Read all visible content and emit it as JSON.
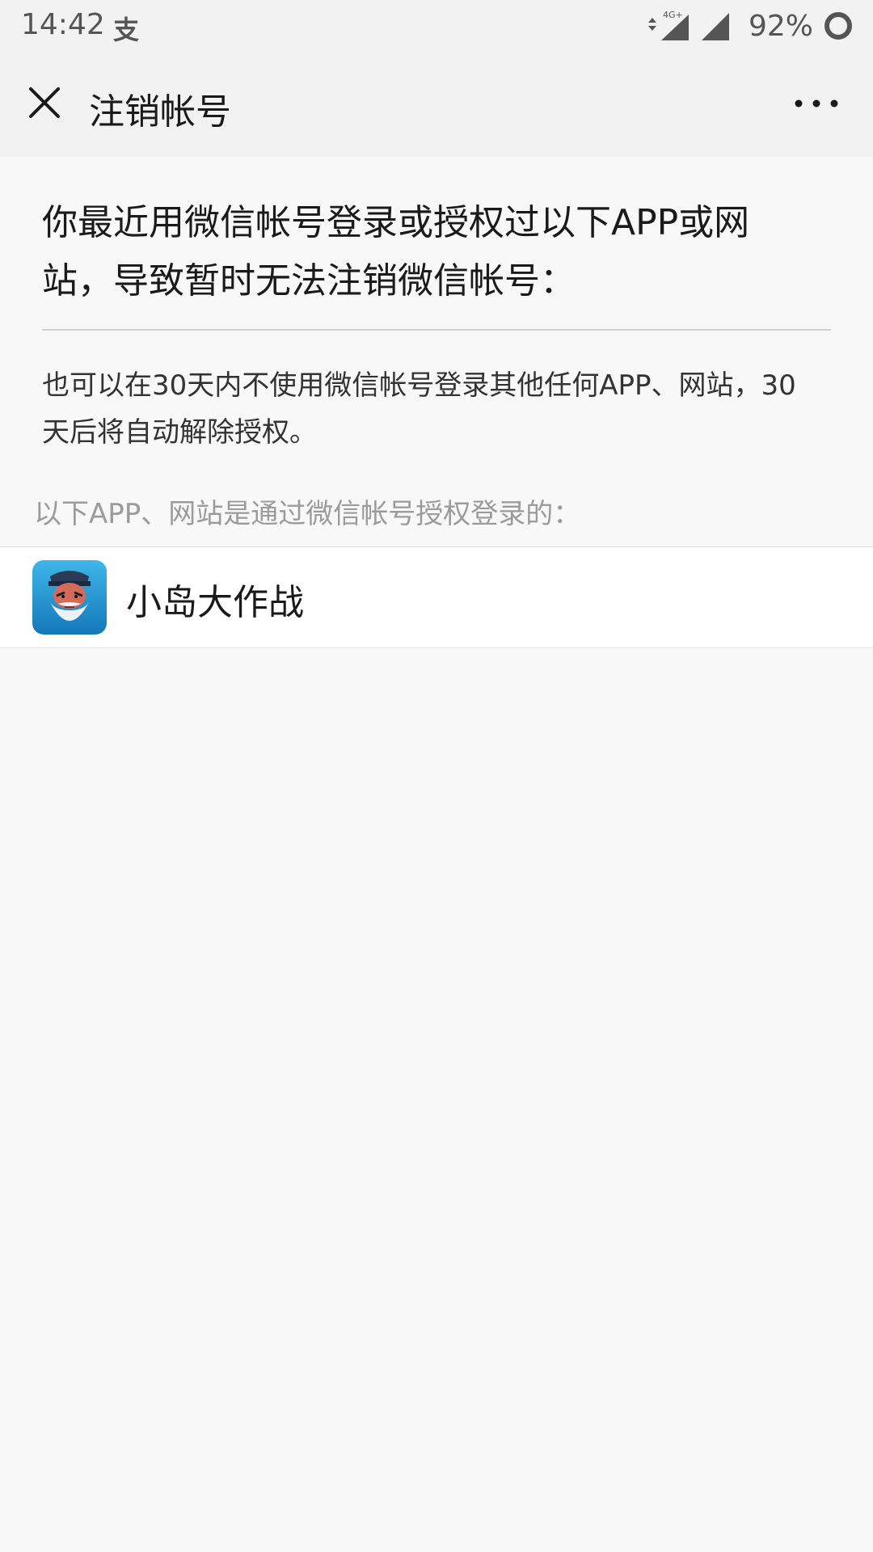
{
  "status_bar": {
    "time": "14:42",
    "app_icon": "支",
    "network": "4G+",
    "battery": "92%"
  },
  "nav": {
    "title": "注销帐号"
  },
  "content": {
    "heading": "你最近用微信帐号登录或授权过以下APP或网站，导致暂时无法注销微信帐号：",
    "subtext": "也可以在30天内不使用微信帐号登录其他任何APP、网站，30天后将自动解除授权。",
    "section_label": "以下APP、网站是通过微信帐号授权登录的："
  },
  "apps": [
    {
      "name": "小岛大作战",
      "icon": "game-character-icon"
    }
  ],
  "colors": {
    "bar_bg": "#f2f2f2",
    "page_bg": "#f8f8f8",
    "muted_text": "#9b9b9b"
  }
}
